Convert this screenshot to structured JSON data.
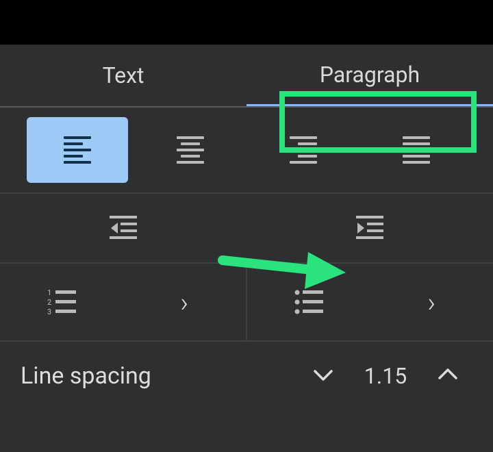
{
  "tabs": {
    "text": "Text",
    "paragraph": "Paragraph",
    "active": "paragraph"
  },
  "alignment": {
    "selected": "left"
  },
  "indent": {
    "decrease": "decrease-indent",
    "increase": "increase-indent"
  },
  "lists": {
    "numbered": "numbered-list",
    "bulleted": "bulleted-list"
  },
  "lineSpacing": {
    "label": "Line spacing",
    "value": "1.15"
  },
  "annotations": {
    "paragraph_tab_highlighted": true,
    "arrow_to_increase_indent": true
  }
}
